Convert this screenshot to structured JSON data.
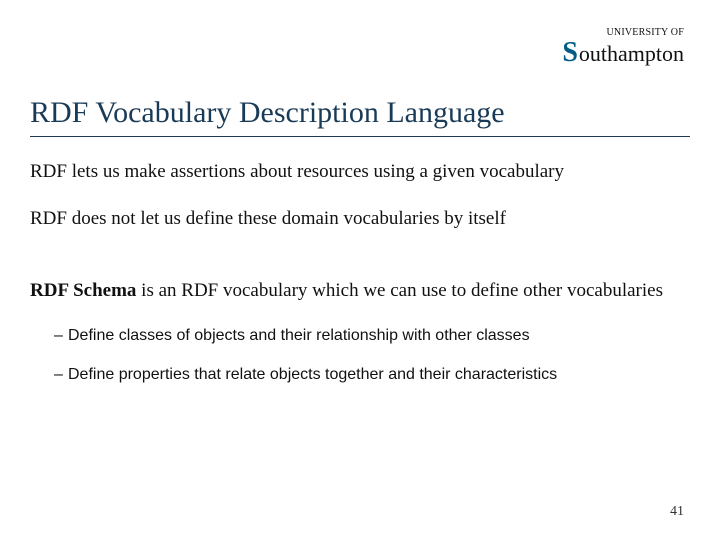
{
  "logo": {
    "top_line": "UNIVERSITY OF",
    "name": "outhampton"
  },
  "title": "RDF Vocabulary Description Language",
  "paragraphs": {
    "p1": "RDF lets us make assertions about resources using a given vocabulary",
    "p2": "RDF does not let us define these domain vocabularies by itself",
    "p3_bold": "RDF Schema",
    "p3_rest": " is an RDF vocabulary which we can use to define other vocabularies"
  },
  "bullets": {
    "b1": "Define classes of objects and their relationship with other classes",
    "b2": "Define properties that relate objects together and their characteristics"
  },
  "page_number": "41"
}
